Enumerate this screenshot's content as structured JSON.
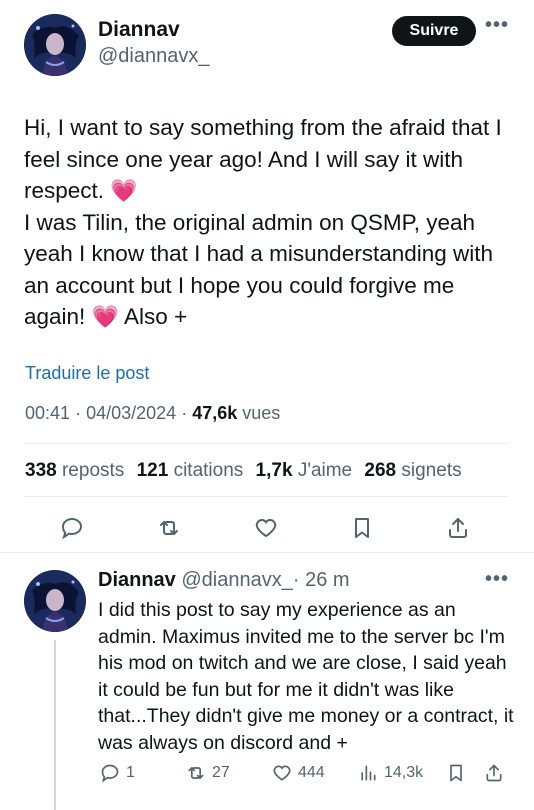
{
  "post": {
    "author": {
      "name": "Diannav",
      "handle": "@diannavx_"
    },
    "follow_label": "Suivre",
    "more_label": "•••",
    "body_lines": [
      "Hi, I want to say something from the afraid that I feel since one year ago! And I will say it with respect.",
      "I was Tilin, the original admin on QSMP, yeah yeah I know that I had a misunderstanding with an account but I hope you could forgive me again!",
      "Also +"
    ],
    "emoji": "💗",
    "translate_label": "Traduire le post",
    "time": "00:41",
    "separator": "·",
    "date": "04/03/2024",
    "views_count": "47,6k",
    "views_label": "vues",
    "stats": {
      "reposts_count": "338",
      "reposts_label": "reposts",
      "quotes_count": "121",
      "quotes_label": "citations",
      "likes_count": "1,7k",
      "likes_label": "J'aime",
      "bookmarks_count": "268",
      "bookmarks_label": "signets"
    }
  },
  "reply": {
    "author": {
      "name": "Diannav",
      "handle": "@diannavx_",
      "time": "26 m"
    },
    "separator": "·",
    "more_label": "•••",
    "body": "I did this post to say my experience as an admin. Maximus invited me to the server bc I'm his mod on twitch and we are close, I said yeah it could be fun but for me it didn't was like that...They didn't give me money or a contract, it was always on discord and +",
    "actions": {
      "replies": "1",
      "reposts": "27",
      "likes": "444",
      "views": "14,3k"
    }
  },
  "colors": {
    "accent": "#1d6fa5",
    "muted": "#536471",
    "text": "#0f1419",
    "heart": "#e0249a"
  }
}
